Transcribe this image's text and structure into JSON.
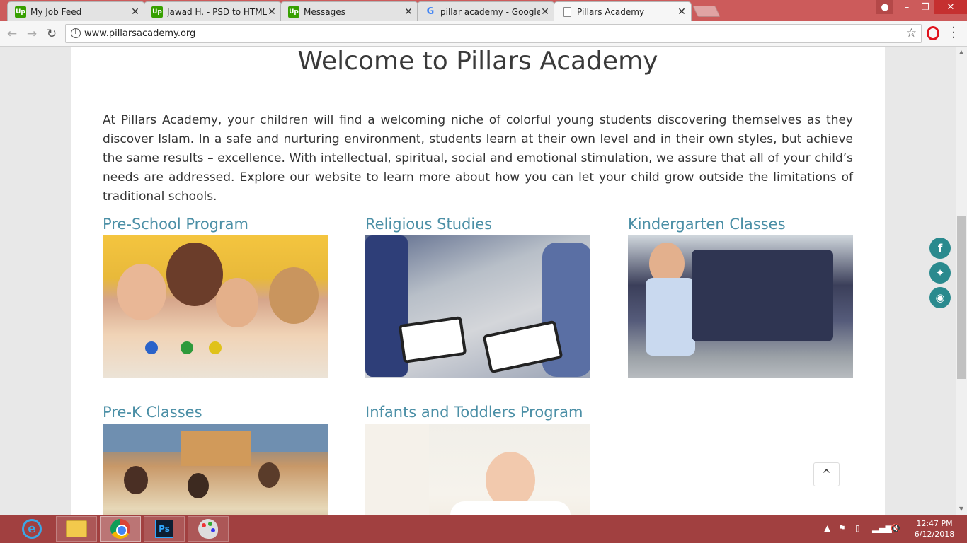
{
  "browser": {
    "tabs": [
      {
        "label": "My Job Feed",
        "favicon": "upwork-icon",
        "active": false
      },
      {
        "label": "Jawad H. - PSD to HTML/",
        "favicon": "upwork-icon",
        "active": false
      },
      {
        "label": "Messages",
        "favicon": "upwork-icon",
        "active": false
      },
      {
        "label": "pillar academy - Google S",
        "favicon": "google-icon",
        "active": false
      },
      {
        "label": "Pillars Academy",
        "favicon": "document-icon",
        "active": true
      }
    ],
    "tab_close_glyph": "✕",
    "url": "www.pillarsacademy.org"
  },
  "page": {
    "title": "Welcome to Pillars Academy",
    "intro": "At Pillars Academy, your children will find a welcoming niche of colorful young students discovering themselves as they discover Islam. In a safe and nurturing environment, students learn at their own level and in their own styles, but achieve the same results – excellence. With intellectual, spiritual, social and emotional stimulation, we assure that all of your child’s needs are addressed. Explore our website to learn more about how you can let your child grow outside the limitations of traditional schools.",
    "programs": [
      {
        "title": "Pre-School Program"
      },
      {
        "title": "Religious Studies"
      },
      {
        "title": "Kindergarten Classes"
      },
      {
        "title": "Pre-K Classes"
      },
      {
        "title": "Infants and Toddlers Program"
      }
    ],
    "social": [
      {
        "icon": "facebook-icon",
        "glyph": "f"
      },
      {
        "icon": "twitter-icon",
        "glyph": "✦"
      },
      {
        "icon": "rss-icon",
        "glyph": "◉"
      }
    ],
    "back_to_top_glyph": "^"
  },
  "taskbar": {
    "time": "12:47 PM",
    "date": "6/12/2018"
  },
  "colors": {
    "link": "#4b8fa6",
    "social": "#2a8a8e",
    "tab_strip": "#cc5b5b",
    "taskbar": "#a14040"
  }
}
